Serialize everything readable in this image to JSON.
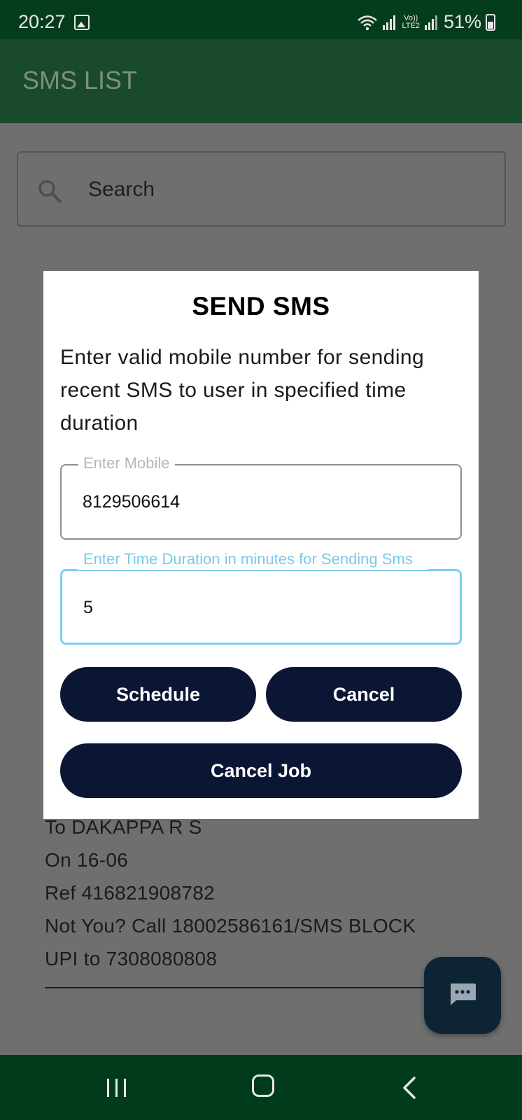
{
  "status_bar": {
    "time": "20:27",
    "network_label_top": "Vo))",
    "network_label_bottom": "LTE2",
    "battery": "51%",
    "icons": [
      "image-icon",
      "wifi-icon",
      "signal-icon",
      "battery-icon"
    ]
  },
  "app_bar": {
    "title": "SMS LIST"
  },
  "search": {
    "placeholder": "Search",
    "icon": "search-icon"
  },
  "background_message": {
    "lines": [
      "To DAKAPPA  R S",
      "On 16-06",
      "Ref 416821908782",
      "Not You? Call 18002586161/SMS BLOCK",
      "UPI to 7308080808"
    ]
  },
  "dialog": {
    "title": "SEND SMS",
    "message": "Enter valid mobile number for sending recent SMS to user in specified time duration",
    "mobile_field": {
      "label": "Enter Mobile",
      "value": "8129506614"
    },
    "duration_field": {
      "label": "Enter Time Duration in minutes for Sending Sms",
      "value": "5"
    },
    "buttons": {
      "schedule": "Schedule",
      "cancel": "Cancel",
      "cancel_job": "Cancel Job"
    }
  },
  "fab": {
    "icon": "message-icon"
  },
  "nav_bar": {
    "icons": [
      "recents-icon",
      "home-icon",
      "back-icon"
    ]
  },
  "colors": {
    "status_bar": "#053d1c",
    "app_bar": "#184a2b",
    "scrim": "#6f6f6f",
    "button": "#0b1634",
    "focus_accent": "#7fd0ee",
    "nav_bar": "#003c1c"
  }
}
